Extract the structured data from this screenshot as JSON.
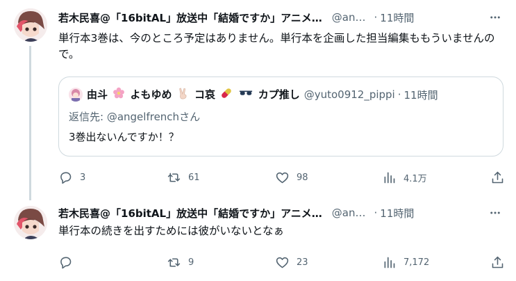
{
  "tweets": [
    {
      "author_name": "若木民喜@「16bitAL」放送中「結婚ですか」アニメ…",
      "handle": "@an…",
      "time": "11時間",
      "text": "単行本3巻は、今のところ予定はありません。単行本を企画した担当編集ももういませんので。",
      "quote": {
        "author_name_parts": [
          "由斗",
          "よもゆめ",
          "コ哀",
          "カプ推し"
        ],
        "handle": "@yuto0912_pippi",
        "time": "11時間",
        "reply_prefix": "返信先: ",
        "reply_mention": "@angelfrench",
        "reply_suffix": "さん",
        "text": "3巻出ないんですか！？"
      },
      "stats": {
        "replies": "3",
        "retweets": "61",
        "likes": "98",
        "views": "4.1万"
      }
    },
    {
      "author_name": "若木民喜@「16bitAL」放送中「結婚ですか」アニメ…",
      "handle": "@an…",
      "time": "11時間",
      "text": "単行本の続きを出すためには彼がいないとなぁ",
      "stats": {
        "replies": "",
        "retweets": "9",
        "likes": "23",
        "views": "7,172"
      }
    }
  ],
  "ui": {
    "dot": "·",
    "more": "···"
  },
  "icons": {
    "reply": "reply-icon",
    "retweet": "retweet-icon",
    "like": "heart-icon",
    "views": "views-icon",
    "share": "share-icon",
    "more": "more-icon"
  },
  "colors": {
    "text": "#0f1419",
    "muted": "#536471",
    "border": "#cfd9de",
    "line": "#cfd9de"
  }
}
